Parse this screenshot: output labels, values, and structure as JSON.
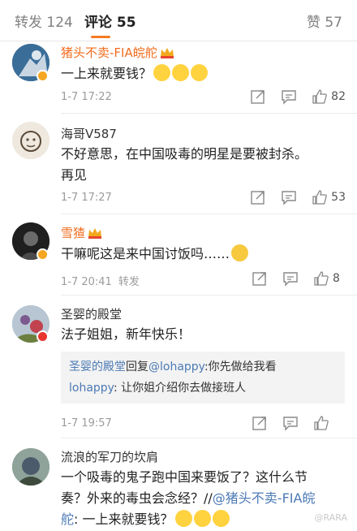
{
  "tabs": [
    {
      "label": "转发",
      "count": "124"
    },
    {
      "label": "评论",
      "count": "55"
    },
    {
      "label": "赞",
      "count": "57"
    }
  ],
  "comments": [
    {
      "user": "猪头不卖-FIA皖舵",
      "text": "一上来就要钱？",
      "time": "1-7 17:22",
      "likes": "82"
    },
    {
      "user": "海哥V587",
      "text_line1": "不好意思，在中国吸毒的明星是要被封杀。",
      "text_line2": "再见",
      "time": "1-7 17:27",
      "likes": "53"
    },
    {
      "user": "雪猹",
      "text": "干嘛呢这是来中国讨饭吗……",
      "time": "1-7 20:41",
      "repost_label": "转发",
      "likes": "8"
    },
    {
      "user": "圣婴的殿堂",
      "text": "法子姐姐，新年快乐！",
      "reply1_user": "圣婴的殿堂",
      "reply1_mid": "回复",
      "reply1_target": "@lohappy",
      "reply1_text": ":你先做给我看",
      "reply2_user": "lohappy",
      "reply2_text": ": 让你姐介绍你去做接班人",
      "time": "1-7 19:57",
      "likes": ""
    },
    {
      "user": "流浪的军刀的坎肩",
      "text_line1": "一个吸毒的鬼子跑中国来要饭了？这什么节",
      "text_line2_a": "奏？外来的毒虫会念经？//",
      "mention": "@猪头不卖-FIA皖",
      "text_line3_mention": "舵",
      "text_line3": ": 一上来就要钱？"
    }
  ],
  "watermark": "@RARA"
}
